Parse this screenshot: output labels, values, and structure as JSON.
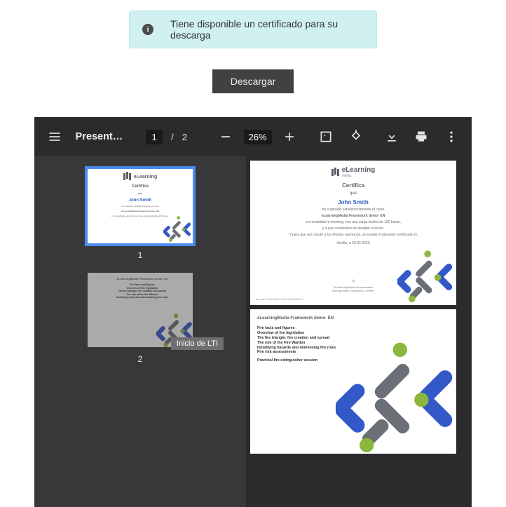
{
  "notice": {
    "text": "Tiene disponible un certificado para su descarga"
  },
  "download": {
    "label": "Descargar"
  },
  "pdf": {
    "title": "Presentación",
    "current_page": "1",
    "total_pages": "2",
    "separator": "/",
    "zoom": "26%"
  },
  "thumbs": {
    "nums": [
      "1",
      "2"
    ],
    "selected": 0,
    "tooltip": "Inicio de LTI"
  },
  "cert": {
    "brand": "eLearning",
    "brand_sub": "media",
    "certifica": "Certifica",
    "que": "que",
    "name": "John Smith",
    "l1": "ha superado satisfactoriamente el curso",
    "course": "eLearningMedia Framework demo- EN",
    "l2": "en modalidad e-learning, con una carga lectiva de 100  horas,",
    "l3": "y cuyos contenidos se detallan al dorso.",
    "l4": "Y para que así conste a los efectos oportunos, se expide el presente certificado en",
    "city_date": "Sevilla, a   29-03-2025",
    "sig1": "Nombre Apellidos Responsable",
    "sig2": "Director Área Formación y RRHH",
    "hash": "aa-c4517ba2639bb1250ed325c50cd1"
  },
  "page2": {
    "heading": "eLearningMedia Framework demo- EN",
    "items": [
      "Fire facts and figures",
      "Overview of fire legislation",
      "The fire triangle: fire creation and spread",
      "The role of the Fire Warden",
      "Identifying hazards and minimising fire risks",
      "Fire risk assessments",
      "",
      "Practical fire extinguisher session"
    ]
  },
  "colors": {
    "blue": "#3358c8",
    "grey": "#6b6f76",
    "green": "#8cb63d"
  }
}
